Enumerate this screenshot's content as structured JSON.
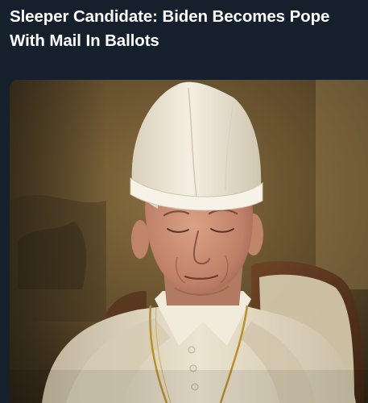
{
  "post": {
    "headline": "Sleeper Candidate: Biden Becomes Pope With Mail In Ballots"
  },
  "image": {
    "subject": "pope-portrait",
    "colors": {
      "background": "#16202c",
      "headline_text": "#ffffff",
      "wall_warm": "#6b5634",
      "mitre_white": "#ece6d6",
      "cassock_cream": "#e3dac5",
      "gold_chain": "#b8902e",
      "skin": "#c98d72"
    }
  }
}
